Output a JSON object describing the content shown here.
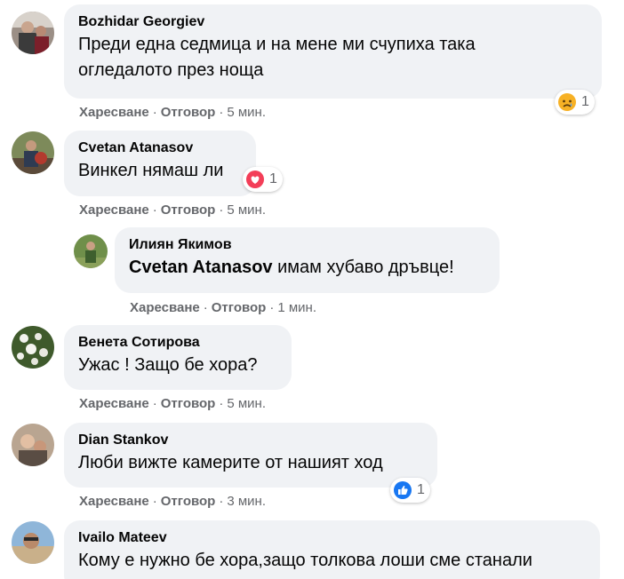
{
  "actions": {
    "like": "Харесване",
    "reply": "Отговор",
    "sep": "·"
  },
  "comments": [
    {
      "author": "Bozhidar Georgiev",
      "lines": [
        "Преди една седмица и на мене ми счупиха така",
        "огледалото през нощa"
      ],
      "time": "5 мин.",
      "reaction": {
        "icon": "sad-reaction-icon",
        "count": "1",
        "color": "#f7b125"
      }
    },
    {
      "author": "Cvetan Atanasov",
      "lines": [
        "Винкел нямаш ли"
      ],
      "time": "5 мин.",
      "reaction": {
        "icon": "love-reaction-icon",
        "count": "1",
        "color": "#f33e58"
      }
    },
    {
      "author": "Илиян Якимов",
      "mention": "Cvetan Atanasov",
      "lines": [
        "имам хубаво дръвце!"
      ],
      "time": "1 мин."
    },
    {
      "author": "Венета Сотирова",
      "lines": [
        "Ужас ! Защо бе хора?"
      ],
      "time": "5 мин."
    },
    {
      "author": "Dian Stankov",
      "lines": [
        "Люби вижте камерите от нашият ход"
      ],
      "time": "3 мин.",
      "reaction": {
        "icon": "like-reaction-icon",
        "count": "1",
        "color": "#1877f2"
      }
    },
    {
      "author": "Ivailo Mateev",
      "lines": [
        "Кому е нужно бе хора,защо толкова лоши сме станали"
      ]
    }
  ]
}
